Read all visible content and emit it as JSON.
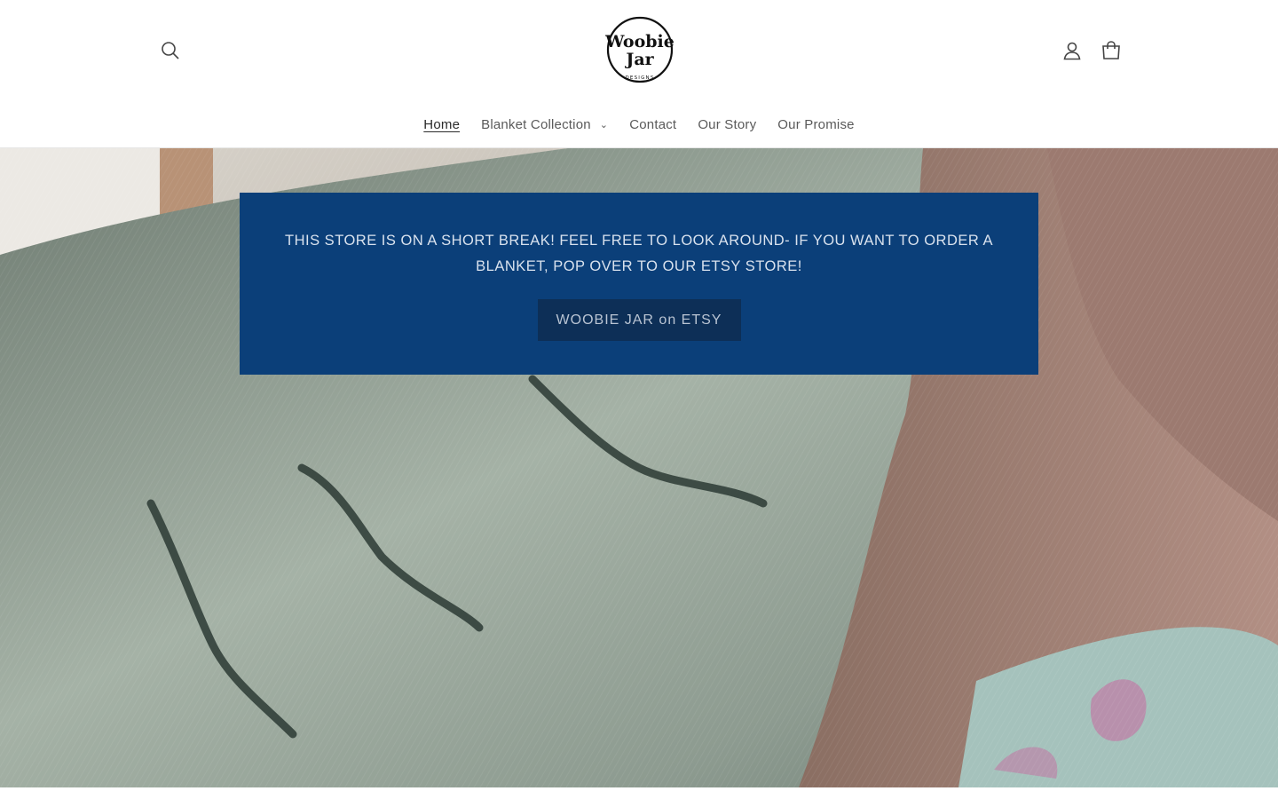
{
  "header": {
    "logo": {
      "line1": "Woobie",
      "line2": "Jar",
      "tagline": "DESIGNS"
    },
    "icons": {
      "search": "search-icon",
      "account": "account-icon",
      "cart": "cart-icon"
    }
  },
  "nav": {
    "items": [
      {
        "label": "Home",
        "active": true
      },
      {
        "label": "Blanket Collection",
        "has_dropdown": true
      },
      {
        "label": "Contact"
      },
      {
        "label": "Our Story"
      },
      {
        "label": "Our Promise"
      }
    ]
  },
  "banner": {
    "message": "THIS STORE IS ON A SHORT BREAK! FEEL FREE TO LOOK AROUND- IF YOU WANT TO ORDER A BLANKET, POP OVER TO OUR ETSY STORE!",
    "button_label": "WOOBIE JAR on ETSY",
    "background_color": "#0b3f79",
    "button_color": "#0d2f57"
  }
}
